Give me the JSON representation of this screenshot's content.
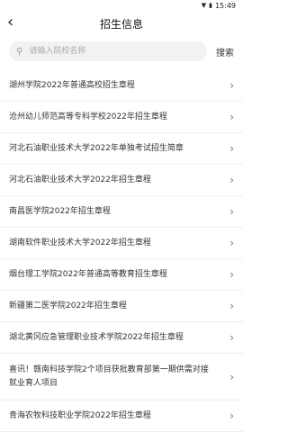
{
  "status": {
    "time": "15:49"
  },
  "header": {
    "title": "招生信息"
  },
  "search": {
    "placeholder": "请输入院校名称",
    "button": "搜索"
  },
  "items": [
    "湖州学院2022年普通高校招生章程",
    "沧州幼儿师范高等专科学校2022年招生章程",
    "河北石油职业技术大学2022年单独考试招生简章",
    "河北石油职业技术大学2022年招生章程",
    "南昌医学院2022年招生章程",
    "湖南软件职业技术大学2022年招生章程",
    "烟台理工学院2022年普通高等教育招生章程",
    "新疆第二医学院2022年招生章程",
    "湖北黄冈应急管理职业技术学院2022年招生章程",
    "喜讯！赣南科技学院2个项目获批教育部第一期供需对接就业育人项目",
    "青海农牧科技职业学院2022年招生章程"
  ]
}
